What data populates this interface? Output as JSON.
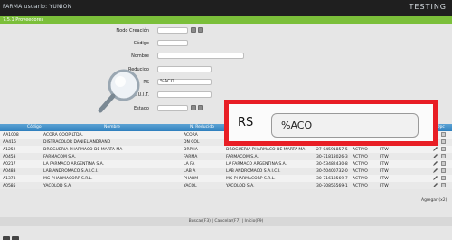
{
  "header": {
    "user": "FARMA usuario: YUNION",
    "env": "TESTING",
    "section_title": "7.5.1 Proveedores"
  },
  "form": {
    "fields": [
      {
        "label": "Nodo Creación",
        "value": ""
      },
      {
        "label": "Código",
        "value": ""
      },
      {
        "label": "Nombre",
        "value": ""
      },
      {
        "label": "Reducido",
        "value": ""
      },
      {
        "label": "RS",
        "value": "%ACO"
      },
      {
        "label": "C.U.I.T.",
        "value": ""
      },
      {
        "label": "Estado",
        "value": ""
      }
    ]
  },
  "table": {
    "columns": [
      "Código",
      "Nombre",
      "N. Reducido",
      "Opc"
    ],
    "rows": [
      {
        "code": "AA1008",
        "name": "ACORA COOP LTDA.",
        "short": "ACORA",
        "rs": "",
        "cuit": "",
        "estado": "",
        "tipo": ""
      },
      {
        "code": "AA416",
        "name": "DISTRACOLOR DANIEL ANDRANO",
        "short": "DN COL",
        "rs": "",
        "cuit": "",
        "estado": "",
        "tipo": ""
      },
      {
        "code": "A1252",
        "name": "DROGUERIA PHARMACO DE MARTA MA",
        "short": "DRPHA",
        "rs": "DROGUERIA PHARMACO DE MARTA MA",
        "cuit": "27-04591857-5",
        "estado": "ACTIVO",
        "tipo": "FTW"
      },
      {
        "code": "A0453",
        "name": "FARMACOM S.A.",
        "short": "FARMA",
        "rs": "FARMACOM S.A.",
        "cuit": "30-71818026-3",
        "estado": "ACTIVO",
        "tipo": "FTW"
      },
      {
        "code": "A0217",
        "name": "LA FARMACO ARGENTINA S.A.",
        "short": "LA FA",
        "rs": "LA FARMACO ARGENTINA S.A.",
        "cuit": "30-53482430-8",
        "estado": "ACTIVO",
        "tipo": "FTW"
      },
      {
        "code": "A0483",
        "name": "LAB ANDROMACO S.A.I.C.I.",
        "short": "LAB A",
        "rs": "LAB ANDROMACO S.A.I.C.I.",
        "cuit": "30-50400732-0",
        "estado": "ACTIVO",
        "tipo": "FTW"
      },
      {
        "code": "A1373",
        "name": "MG PHARMACORP S.R.L.",
        "short": "PHARM",
        "rs": "MG PHARMACORP S.R.L.",
        "cuit": "30-71618569-7",
        "estado": "ACTIVO",
        "tipo": "FTW"
      },
      {
        "code": "A0585",
        "name": "YACOLOD S.A.",
        "short": "YACOL",
        "rs": "YACOLOD S.A.",
        "cuit": "30-70856569-1",
        "estado": "ACTIVO",
        "tipo": "FTW"
      }
    ]
  },
  "footer": {
    "agregar": "Agregar (x2)",
    "links": "Buscar(F3) | Cancelar(F7) | Inicio(F9)"
  },
  "zoom": {
    "label": "RS",
    "value": "%ACO"
  },
  "colors": {
    "accent_green": "#7bbf3a",
    "header_blue": "#2e7fbd",
    "highlight_red": "#e81e25"
  }
}
